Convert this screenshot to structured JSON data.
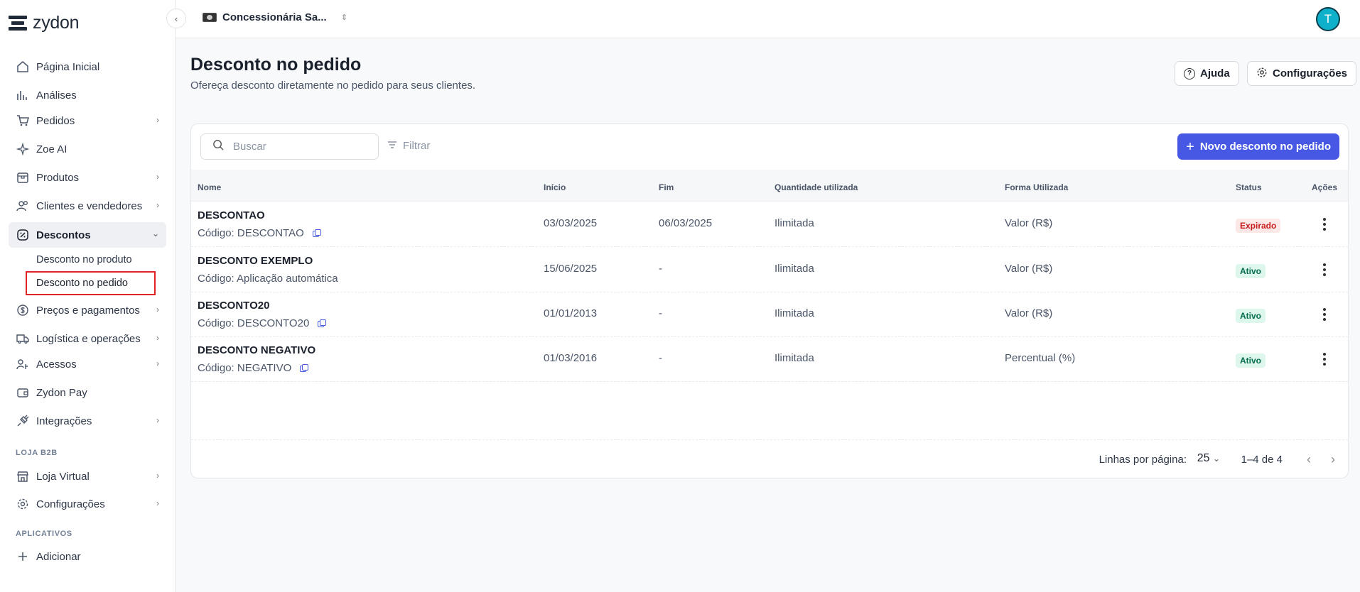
{
  "brand": {
    "name": "zydon"
  },
  "store": {
    "name": "Concessionária Sa..."
  },
  "user": {
    "initial": "T"
  },
  "sidebar": {
    "items": [
      {
        "label": "Página Inicial",
        "icon": "home-icon"
      },
      {
        "label": "Análises",
        "icon": "chart-bars-icon"
      },
      {
        "label": "Pedidos",
        "icon": "cart-icon"
      },
      {
        "label": "Zoe AI",
        "icon": "sparkles-icon"
      },
      {
        "label": "Produtos",
        "icon": "box-icon"
      },
      {
        "label": "Clientes e vendedores",
        "icon": "users-icon"
      },
      {
        "label": "Descontos",
        "icon": "discount-icon"
      },
      {
        "label": "Preços e pagamentos",
        "icon": "money-icon"
      },
      {
        "label": "Logística e operações",
        "icon": "truck-icon"
      },
      {
        "label": "Acessos",
        "icon": "key-users-icon"
      },
      {
        "label": "Zydon Pay",
        "icon": "wallet-icon"
      },
      {
        "label": "Integrações",
        "icon": "plug-icon"
      },
      {
        "label": "Loja Virtual",
        "icon": "storefront-icon"
      },
      {
        "label": "Configurações",
        "icon": "gear-icon"
      },
      {
        "label": "Adicionar",
        "icon": "plus-icon"
      }
    ],
    "sub_items": [
      "Desconto no produto",
      "Desconto no pedido"
    ],
    "sections": [
      "LOJA B2B",
      "APLICATIVOS"
    ]
  },
  "page": {
    "title": "Desconto no pedido",
    "subtitle": "Ofereça desconto diretamente no pedido para seus clientes.",
    "help_label": "Ajuda",
    "settings_label": "Configurações"
  },
  "toolbar": {
    "search_placeholder": "Buscar",
    "filter_label": "Filtrar",
    "new_label": "Novo desconto no pedido"
  },
  "table": {
    "columns": [
      "Nome",
      "Início",
      "Fim",
      "Quantidade utilizada",
      "Forma Utilizada",
      "Status",
      "Ações"
    ],
    "rows": [
      {
        "name": "DESCONTAO",
        "code": "Código: DESCONTAO",
        "copy": true,
        "start": "03/03/2025",
        "end": "06/03/2025",
        "qty": "Ilimitada",
        "form": "Valor (R$)",
        "status": "Expirado"
      },
      {
        "name": "DESCONTO EXEMPLO",
        "code": "Código: Aplicação automática",
        "copy": false,
        "start": "15/06/2025",
        "end": "-",
        "qty": "Ilimitada",
        "form": "Valor (R$)",
        "status": "Ativo"
      },
      {
        "name": "DESCONTO20",
        "code": "Código: DESCONTO20",
        "copy": true,
        "start": "01/01/2013",
        "end": "-",
        "qty": "Ilimitada",
        "form": "Valor (R$)",
        "status": "Ativo"
      },
      {
        "name": "DESCONTO NEGATIVO",
        "code": "Código: NEGATIVO",
        "copy": true,
        "start": "01/03/2016",
        "end": "-",
        "qty": "Ilimitada",
        "form": "Percentual (%)",
        "status": "Ativo"
      }
    ]
  },
  "pagination": {
    "rows_label": "Linhas por página:",
    "rows_per_page": "25",
    "range": "1–4 de 4"
  },
  "colors": {
    "accent": "#4759e4",
    "expired": "#c81e1e",
    "active": "#046c4e",
    "highlight": "#e02424"
  }
}
